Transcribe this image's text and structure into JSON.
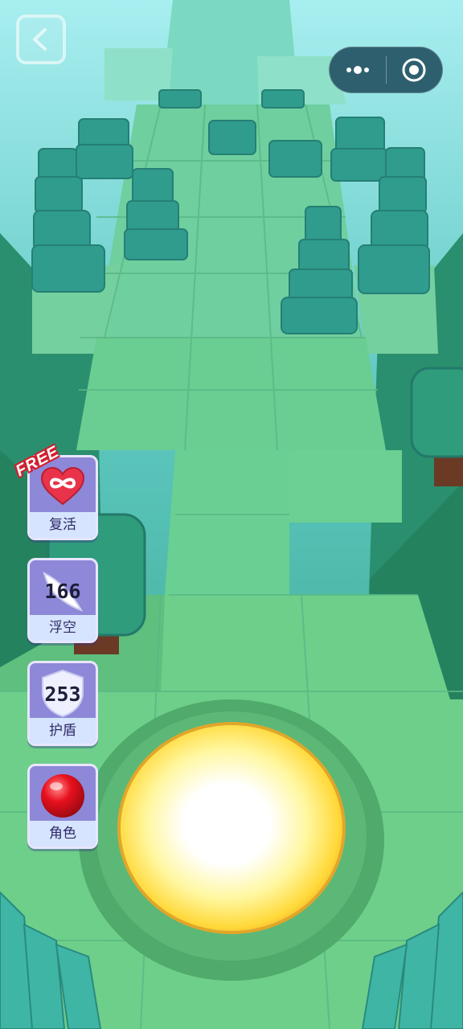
{
  "game": {
    "powerups": [
      {
        "id": "revive",
        "label": "复活",
        "badge": "FREE",
        "icon": "infinity-heart-icon"
      },
      {
        "id": "float",
        "label": "浮空",
        "count": "166",
        "icon": "wing-icon"
      },
      {
        "id": "shield",
        "label": "护盾",
        "count": "253",
        "icon": "shield-icon"
      },
      {
        "id": "character",
        "label": "角色",
        "icon": "red-ball-icon"
      }
    ]
  },
  "system": {
    "back_icon": "chevron-left-icon",
    "menu_icon": "more-dots-icon",
    "close_icon": "target-close-icon"
  },
  "colors": {
    "track": "#6fd39b",
    "tree": "#2f9c8e",
    "ball_glow": "#fff6a8",
    "powerup_bg": "#8d88d8"
  }
}
